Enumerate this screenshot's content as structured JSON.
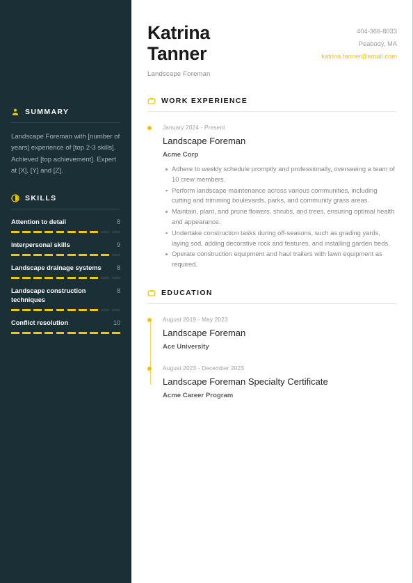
{
  "theme": {
    "sidebar_bg": "#1b2f36",
    "accent": "#f2c900",
    "accent_soft": "#f7d64a",
    "page_bg": "#ffffff"
  },
  "header": {
    "first_name": "Katrina",
    "last_name": "Tanner",
    "role": "Landscape Foreman",
    "contacts": [
      {
        "type": "phone",
        "text": "404-366-8033",
        "accent": false
      },
      {
        "type": "location",
        "text": "Peabody, MA",
        "accent": false
      },
      {
        "type": "email",
        "text": "katrina.tanner@email.com",
        "accent": true
      }
    ]
  },
  "sidebar": {
    "summary": {
      "icon": "person-icon",
      "title": "SUMMARY",
      "text": "Landscape Foreman with [number of years] experience of [top 2-3 skills]. Achieved [top achievement]. Expert at [X], [Y] and [Z]."
    },
    "skills": {
      "icon": "pie-chart-icon",
      "title": "SKILLS",
      "max": 10,
      "items": [
        {
          "name": "Attention to detail",
          "score": "8",
          "value": 8
        },
        {
          "name": "Interpersonal skills",
          "score": "9",
          "value": 9
        },
        {
          "name": "Landscape drainage systems",
          "score": "8",
          "value": 8
        },
        {
          "name": "Landscape construction techniques",
          "score": "8",
          "value": 8
        },
        {
          "name": "Conflict resolution",
          "score": "10",
          "value": 10
        }
      ]
    }
  },
  "main": {
    "work": {
      "icon": "briefcase-icon",
      "title": "WORK EXPERIENCE",
      "entries": [
        {
          "date": "January 2024 - Present",
          "title": "Landscape Foreman",
          "org": "Acme Corp",
          "bullets": [
            "Adhere to weekly schedule promptly and professionally, overseeing a team of 10 crew members.",
            "Perform landscape maintenance across various communities, including cutting and trimming boulevards, parks, and community grass areas.",
            "Maintain, plant, and prune flowers, shrubs, and trees, ensuring optimal health and appearance.",
            "Undertake construction tasks during off-seasons, such as grading yards, laying sod, adding decorative rock and features, and installing garden beds.",
            "Operate construction equipment and haul trailers with lawn equipment as required."
          ]
        }
      ]
    },
    "education": {
      "icon": "briefcase-icon",
      "title": "EDUCATION",
      "entries": [
        {
          "date": "August 2019 - May 2023",
          "title": "Landscape Foreman",
          "org": "Ace University",
          "bullets": []
        },
        {
          "date": "August 2023 - December 2023",
          "title": "Landscape Foreman Specialty Certificate",
          "org": "Acme Career Program",
          "bullets": []
        }
      ]
    }
  }
}
